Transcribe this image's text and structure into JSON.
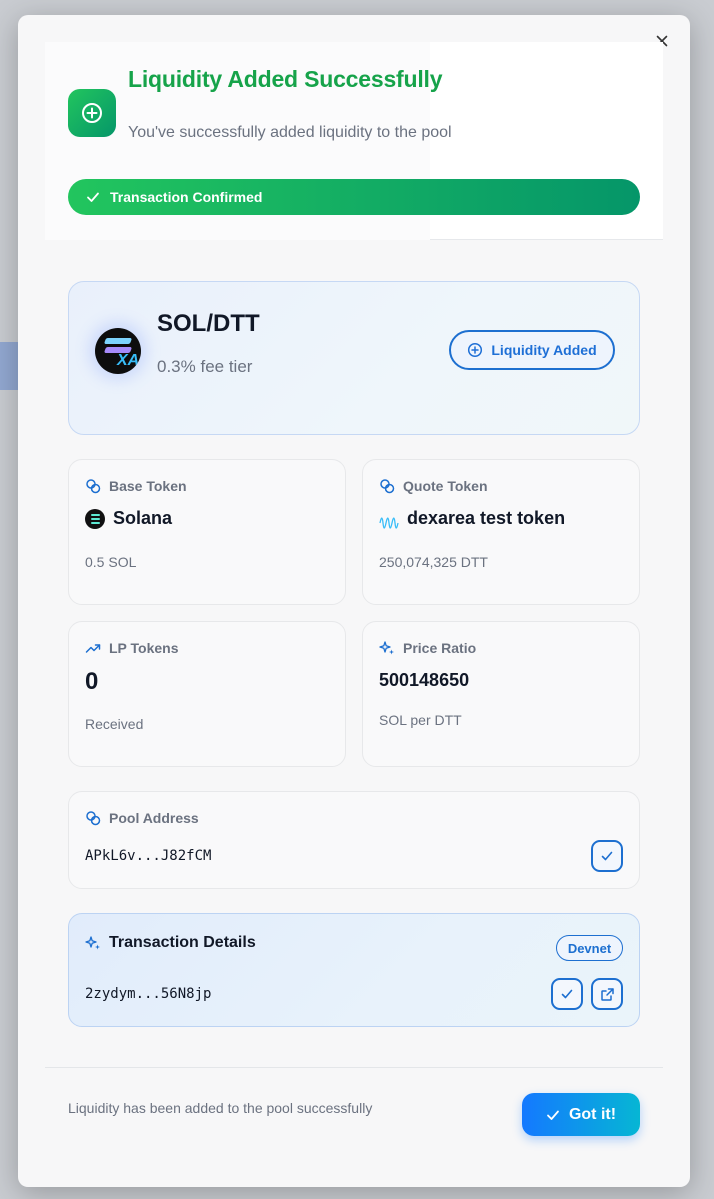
{
  "header": {
    "title": "Liquidity Added Successfully",
    "subtitle": "You've successfully added liquidity to the pool",
    "status": "Transaction Confirmed"
  },
  "pair": {
    "logo_text": "XAF",
    "name": "SOL/DTT",
    "fee_tier": "0.3% fee tier",
    "badge": "Liquidity Added"
  },
  "base_token": {
    "label": "Base Token",
    "name": "Solana",
    "amount": "0.5 SOL"
  },
  "quote_token": {
    "label": "Quote Token",
    "name": "dexarea test token",
    "amount": "250,074,325 DTT"
  },
  "lp_tokens": {
    "label": "LP Tokens",
    "value": "0",
    "sub": "Received"
  },
  "price_ratio": {
    "label": "Price Ratio",
    "value": "500148650",
    "sub": "SOL per DTT"
  },
  "pool_address": {
    "label": "Pool Address",
    "value": "APkL6v...J82fCM"
  },
  "transaction": {
    "label": "Transaction Details",
    "network": "Devnet",
    "hash": "2zydym...56N8jp"
  },
  "footer": {
    "message": "Liquidity has been added to the pool successfully",
    "button": "Got it!"
  },
  "colors": {
    "success": "#16a34a",
    "accent": "#1d6fd0"
  }
}
